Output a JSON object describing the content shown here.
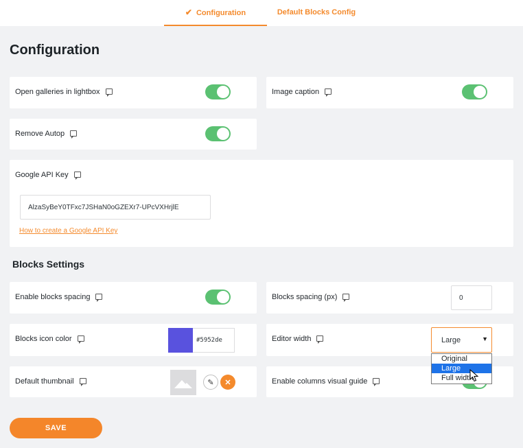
{
  "tabs": [
    {
      "label": "Configuration",
      "active": true,
      "icon": "check-icon"
    },
    {
      "label": "Default Blocks Config",
      "active": false
    }
  ],
  "page_title": "Configuration",
  "settings": {
    "lightbox": {
      "label": "Open galleries in lightbox",
      "enabled": true
    },
    "image_caption": {
      "label": "Image caption",
      "enabled": true
    },
    "remove_autop": {
      "label": "Remove Autop",
      "enabled": true
    },
    "google_api": {
      "label": "Google API Key",
      "value": "AlzaSyBeY0TFxc7JSHaN0oGZEXr7-UPcVXHrjlE",
      "help_link": "How to create a Google API Key"
    }
  },
  "blocks_section_title": "Blocks Settings",
  "blocks": {
    "spacing_toggle": {
      "label": "Enable blocks spacing",
      "enabled": true
    },
    "spacing_px": {
      "label": "Blocks spacing (px)",
      "value": "0"
    },
    "icon_color": {
      "label": "Blocks icon color",
      "value": "#5952de"
    },
    "editor_width": {
      "label": "Editor width",
      "value": "Large",
      "options": [
        "Original",
        "Large",
        "Full width"
      ]
    },
    "default_thumbnail": {
      "label": "Default thumbnail"
    },
    "columns_guide": {
      "label": "Enable columns visual guide",
      "enabled": true
    }
  },
  "save_label": "SAVE",
  "colors": {
    "accent": "#f48a2c",
    "toggle_on": "#5bc172",
    "swatch": "#5952de",
    "selected_option": "#1e73e8"
  }
}
